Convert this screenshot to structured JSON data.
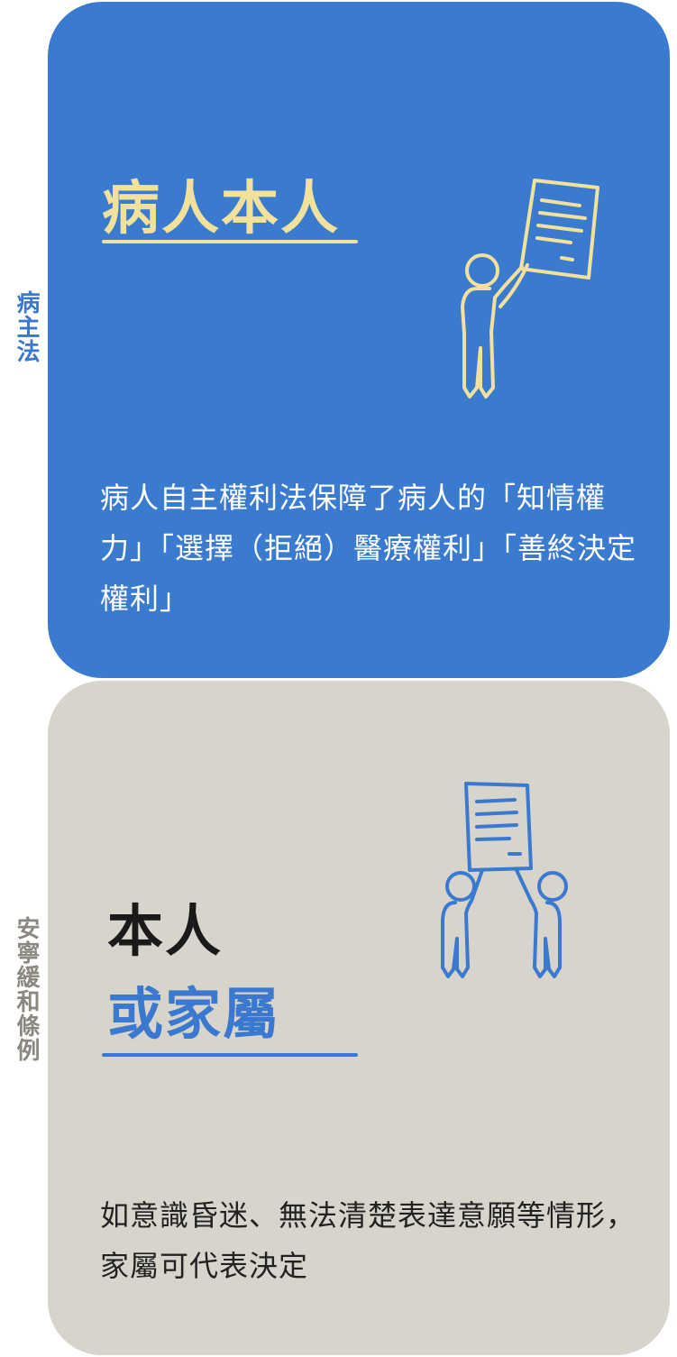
{
  "side_labels": {
    "top": "病主法",
    "bottom": "安寧緩和條例"
  },
  "card_top": {
    "title": "病人本人",
    "description": "病人自主權利法保障了病人的「知情權力」「選擇（拒絕）醫療權利」「善終決定權利」",
    "illustration": "person-raising-document-icon"
  },
  "card_bottom": {
    "title_line1": "本人",
    "title_line2": "或家屬",
    "description": "如意識昏迷、無法清楚表達意願等情形，家屬可代表決定",
    "illustration": "two-people-raising-document-icon"
  },
  "colors": {
    "blue": "#3a7bd0",
    "gray": "#d6d4cb",
    "yellow": "#f2e19a",
    "side_label_top": "#3a79cf",
    "side_label_bottom": "#8a8880"
  }
}
